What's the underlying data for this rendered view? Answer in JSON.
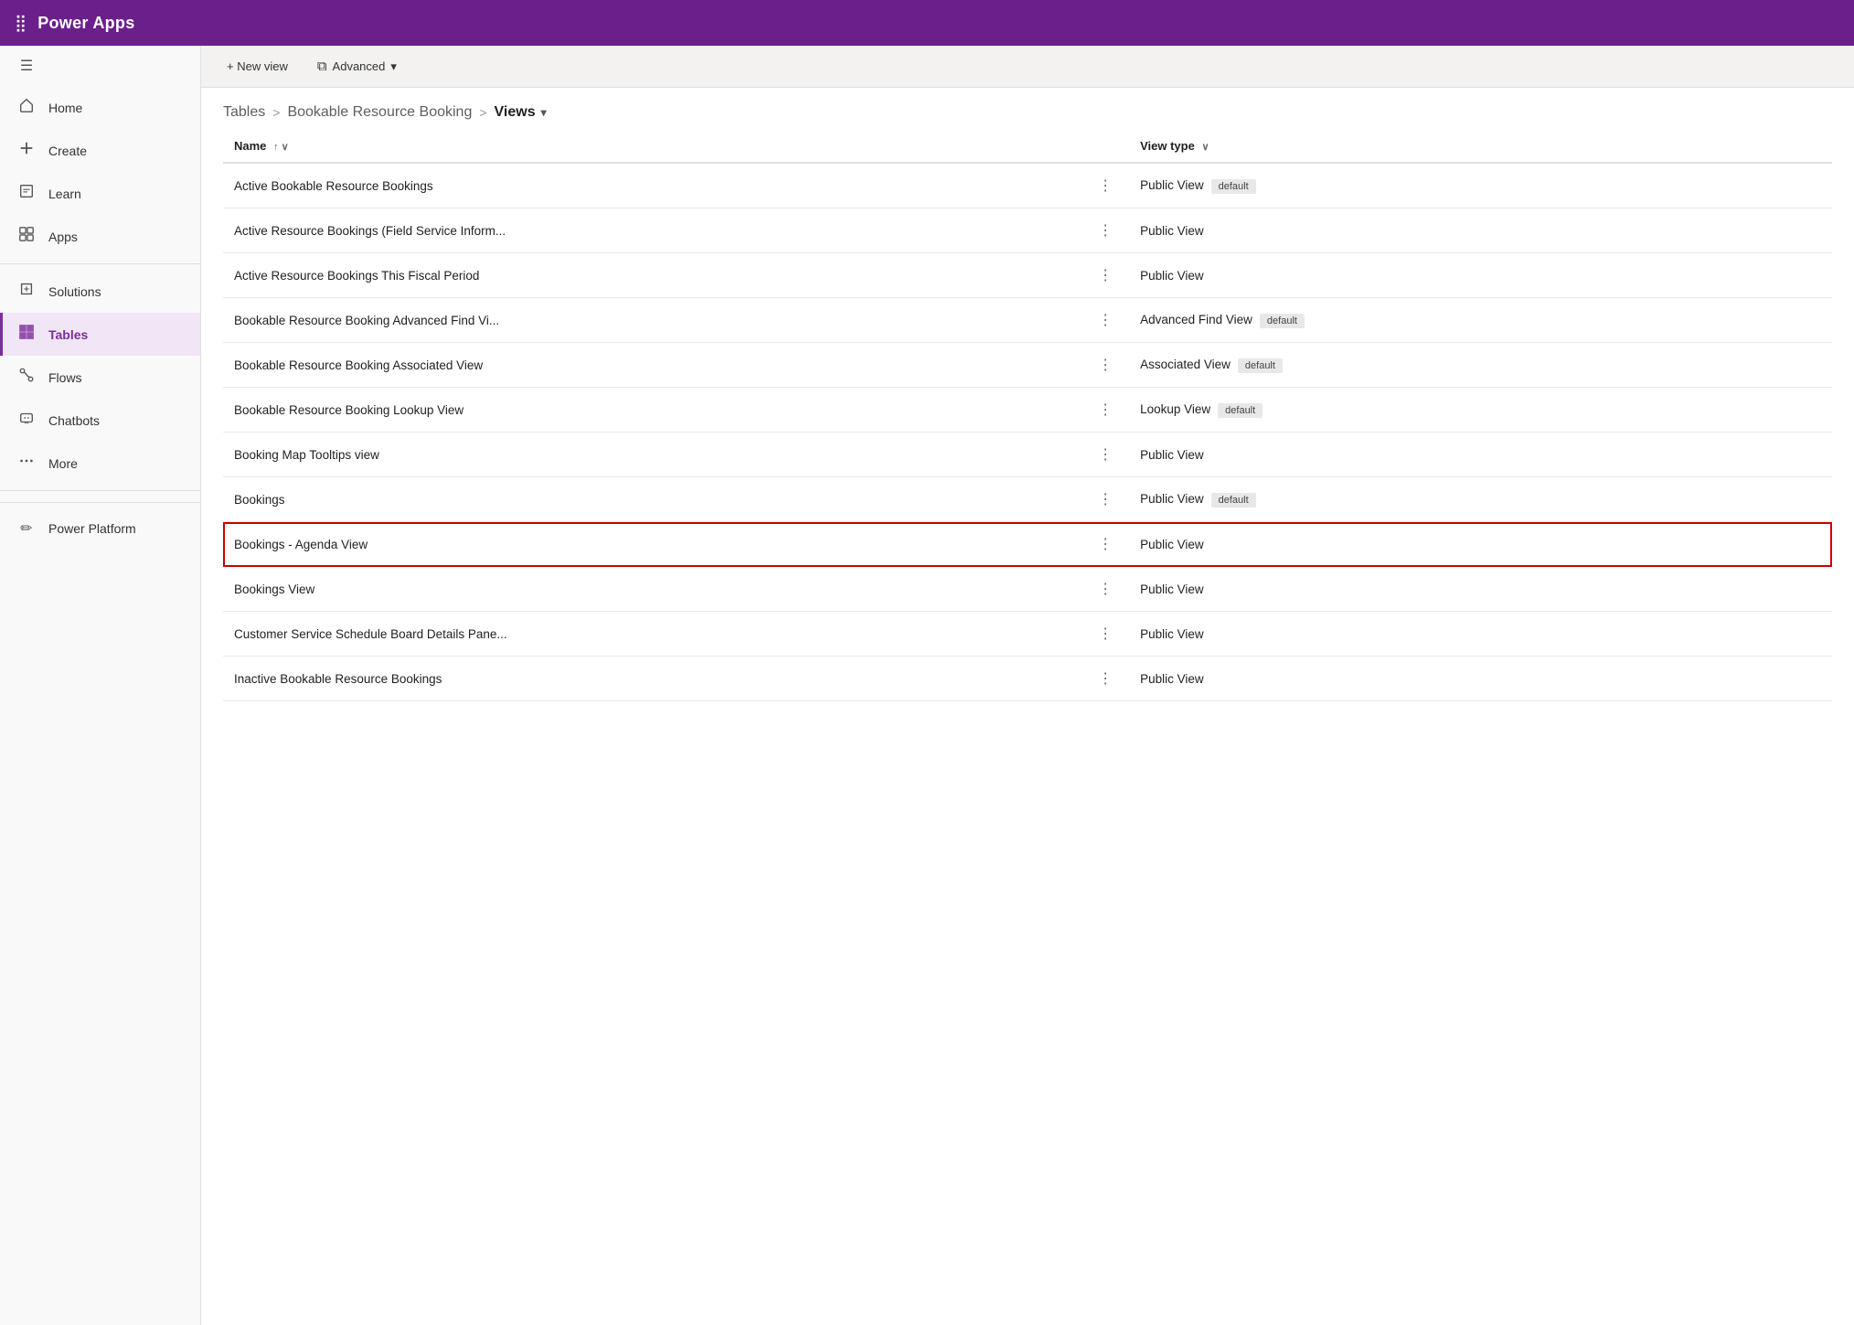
{
  "header": {
    "title": "Power Apps",
    "grid_icon": "⊞"
  },
  "sidebar": {
    "items": [
      {
        "id": "home",
        "label": "Home",
        "icon": "🏠",
        "active": false
      },
      {
        "id": "create",
        "label": "Create",
        "icon": "+",
        "active": false
      },
      {
        "id": "learn",
        "label": "Learn",
        "icon": "📖",
        "active": false
      },
      {
        "id": "apps",
        "label": "Apps",
        "icon": "🎁",
        "active": false
      },
      {
        "id": "solutions",
        "label": "Solutions",
        "icon": "⬛",
        "active": false
      },
      {
        "id": "tables",
        "label": "Tables",
        "icon": "⊞",
        "active": true
      },
      {
        "id": "flows",
        "label": "Flows",
        "icon": "∞",
        "active": false
      },
      {
        "id": "chatbots",
        "label": "Chatbots",
        "icon": "🤖",
        "active": false
      },
      {
        "id": "more",
        "label": "More",
        "icon": "•••",
        "active": false
      },
      {
        "id": "power-platform",
        "label": "Power Platform",
        "icon": "✏",
        "active": false
      }
    ]
  },
  "toolbar": {
    "new_view_label": "+ New view",
    "advanced_label": "Advanced",
    "advanced_chevron": "▾"
  },
  "breadcrumb": {
    "tables_label": "Tables",
    "separator1": ">",
    "table_name": "Bookable Resource Booking",
    "separator2": ">",
    "current_label": "Views",
    "current_chevron": "▾"
  },
  "table": {
    "col_name_label": "Name",
    "col_name_sort": "↑ ∨",
    "col_viewtype_label": "View type",
    "col_viewtype_chevron": "∨",
    "rows": [
      {
        "id": 1,
        "name": "Active Bookable Resource Bookings",
        "view_type": "Public View",
        "badge": "default",
        "highlighted": false
      },
      {
        "id": 2,
        "name": "Active Resource Bookings (Field Service Inform...",
        "view_type": "Public View",
        "badge": "",
        "highlighted": false
      },
      {
        "id": 3,
        "name": "Active Resource Bookings This Fiscal Period",
        "view_type": "Public View",
        "badge": "",
        "highlighted": false
      },
      {
        "id": 4,
        "name": "Bookable Resource Booking Advanced Find Vi...",
        "view_type": "Advanced Find View",
        "badge": "default",
        "highlighted": false
      },
      {
        "id": 5,
        "name": "Bookable Resource Booking Associated View",
        "view_type": "Associated View",
        "badge": "default",
        "highlighted": false
      },
      {
        "id": 6,
        "name": "Bookable Resource Booking Lookup View",
        "view_type": "Lookup View",
        "badge": "default",
        "highlighted": false
      },
      {
        "id": 7,
        "name": "Booking Map Tooltips view",
        "view_type": "Public View",
        "badge": "",
        "highlighted": false
      },
      {
        "id": 8,
        "name": "Bookings",
        "view_type": "Public View",
        "badge": "default",
        "highlighted": false
      },
      {
        "id": 9,
        "name": "Bookings - Agenda View",
        "view_type": "Public View",
        "badge": "",
        "highlighted": true
      },
      {
        "id": 10,
        "name": "Bookings View",
        "view_type": "Public View",
        "badge": "",
        "highlighted": false
      },
      {
        "id": 11,
        "name": "Customer Service Schedule Board Details Pane...",
        "view_type": "Public View",
        "badge": "",
        "highlighted": false
      },
      {
        "id": 12,
        "name": "Inactive Bookable Resource Bookings",
        "view_type": "Public View",
        "badge": "",
        "highlighted": false
      }
    ]
  }
}
